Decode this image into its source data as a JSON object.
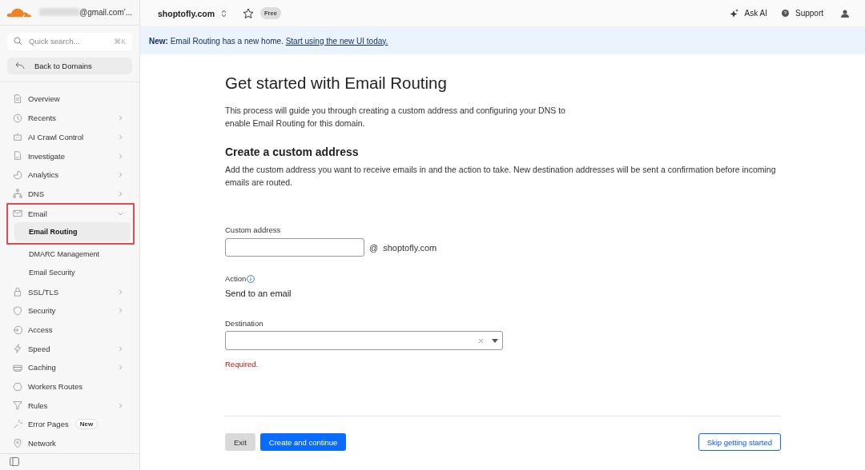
{
  "account": {
    "email": "@gmail.com'..."
  },
  "search": {
    "placeholder": "Quick search...",
    "shortcut": "⌘K"
  },
  "back_button": "Back to Domains",
  "sidebar": {
    "items": [
      {
        "label": "Overview",
        "has_submenu": false
      },
      {
        "label": "Recents",
        "has_submenu": true
      },
      {
        "label": "AI Crawl Control",
        "has_submenu": true
      },
      {
        "label": "Investigate",
        "has_submenu": true
      },
      {
        "label": "Analytics",
        "has_submenu": true
      },
      {
        "label": "DNS",
        "has_submenu": true
      },
      {
        "label": "Email",
        "has_submenu": true,
        "expanded": true,
        "highlighted": true,
        "children": [
          {
            "label": "Email Routing",
            "selected": true,
            "highlighted": true
          },
          {
            "label": "DMARC Management",
            "selected": false,
            "highlighted": false
          },
          {
            "label": "Email Security",
            "selected": false,
            "highlighted": false
          }
        ]
      },
      {
        "label": "SSL/TLS",
        "has_submenu": true
      },
      {
        "label": "Security",
        "has_submenu": true
      },
      {
        "label": "Access",
        "has_submenu": false
      },
      {
        "label": "Speed",
        "has_submenu": true
      },
      {
        "label": "Caching",
        "has_submenu": true
      },
      {
        "label": "Workers Routes",
        "has_submenu": false
      },
      {
        "label": "Rules",
        "has_submenu": true
      },
      {
        "label": "Error Pages",
        "has_submenu": false,
        "badge": "New"
      },
      {
        "label": "Network",
        "has_submenu": false
      }
    ]
  },
  "topbar": {
    "domain": "shoptofly.com",
    "starred": false,
    "plan": "Free",
    "ask_ai": "Ask AI",
    "support": "Support"
  },
  "banner": {
    "lead": "New:",
    "text": "Email Routing has a new home.",
    "link": "Start using the new UI today."
  },
  "page": {
    "title": "Get started with Email Routing",
    "intro": "This process will guide you through creating a custom address and configuring your DNS to enable Email Routing for this domain.",
    "section_title": "Create a custom address",
    "section_text": "Add the custom address you want to receive emails in and the action to take. New destination addresses will be sent a confirmation before incoming emails are routed.",
    "custom_address": {
      "label": "Custom address",
      "at": "@",
      "domain": "shoptofly.com"
    },
    "action": {
      "label": "Action",
      "value": "Send to an email"
    },
    "destination": {
      "label": "Destination",
      "error": "Required."
    },
    "buttons": {
      "exit": "Exit",
      "create": "Create and continue",
      "skip": "Skip getting started"
    }
  }
}
